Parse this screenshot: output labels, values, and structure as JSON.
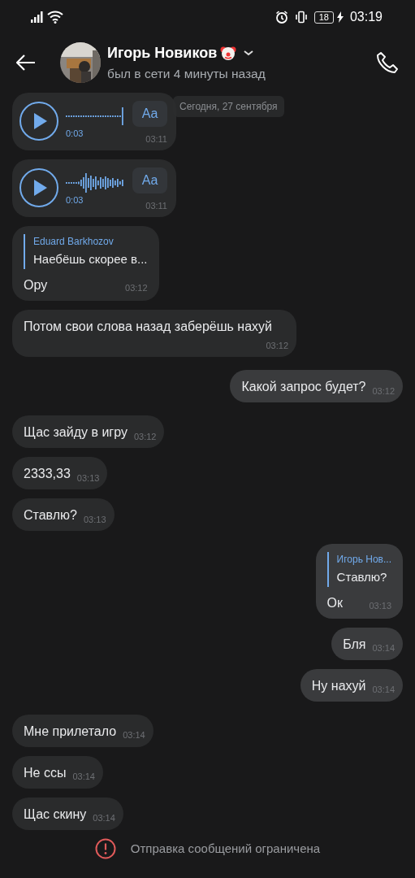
{
  "status_bar": {
    "battery": "18",
    "time": "03:19"
  },
  "header": {
    "name": "Игорь Новиков",
    "status": "был в сети 4 минуты назад"
  },
  "date_badge": "Сегодня, 27 сентября",
  "messages": [
    {
      "kind": "voice",
      "outgoing": false,
      "duration": "0:03",
      "silent": true,
      "transcribe": "Aa",
      "time": "03:11"
    },
    {
      "kind": "voice",
      "outgoing": false,
      "duration": "0:03",
      "silent": false,
      "transcribe": "Aa",
      "time": "03:11"
    },
    {
      "kind": "reply",
      "outgoing": false,
      "quote_author": "Eduard Barkhozov",
      "quote_text": "Наебёшь скорее в...",
      "text": "Ору",
      "time": "03:12"
    },
    {
      "kind": "text",
      "outgoing": false,
      "text": "Потом свои слова назад заберёшь нахуй",
      "time": "03:12"
    },
    {
      "kind": "text",
      "outgoing": true,
      "text": "Какой запрос будет?",
      "time": "03:12"
    },
    {
      "kind": "text",
      "outgoing": false,
      "text": "Щас зайду в игру",
      "time": "03:12"
    },
    {
      "kind": "text",
      "outgoing": false,
      "text": "2333,33",
      "time": "03:13"
    },
    {
      "kind": "text",
      "outgoing": false,
      "text": "Ставлю?",
      "time": "03:13"
    },
    {
      "kind": "reply",
      "outgoing": true,
      "quote_author": "Игорь Нов...",
      "quote_text": "Ставлю?",
      "text": "Ок",
      "time": "03:13"
    },
    {
      "kind": "text",
      "outgoing": true,
      "text": "Бля",
      "time": "03:14"
    },
    {
      "kind": "text",
      "outgoing": true,
      "text": "Ну нахуй",
      "time": "03:14"
    },
    {
      "kind": "text",
      "outgoing": false,
      "text": "Мне прилетало",
      "time": "03:14"
    },
    {
      "kind": "text",
      "outgoing": false,
      "text": "Не ссы",
      "time": "03:14"
    },
    {
      "kind": "text",
      "outgoing": false,
      "text": "Щас скину",
      "time": "03:14"
    }
  ],
  "footer": {
    "notice": "Отправка сообщений ограничена"
  }
}
